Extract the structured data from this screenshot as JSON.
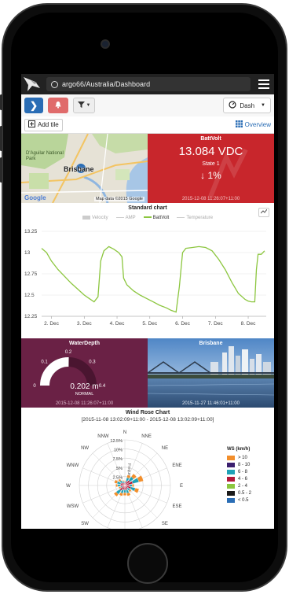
{
  "browser": {
    "url": "argo66/Australia/Dashboard"
  },
  "toolbar": {
    "dash_label": "Dash"
  },
  "toolbar2": {
    "add_tile_label": "Add tile",
    "overview_label": "Overview"
  },
  "map_tile": {
    "labels": [
      "D'Aguilar National Park",
      "Brisbane"
    ],
    "attribution": "Map data ©2015 Google",
    "google_logo": "Google"
  },
  "batt_tile": {
    "title": "BattVolt",
    "value": "13.084 VDC",
    "state": "State 1",
    "change": "1%",
    "timestamp": "2015-12-08 11:26:07+11:00",
    "color": "#c8262c"
  },
  "chart": {
    "title": "Standard chart",
    "legend": [
      {
        "name": "Velocity",
        "active": false,
        "kind": "box"
      },
      {
        "name": "AMP",
        "active": false,
        "kind": "line"
      },
      {
        "name": "BattVolt",
        "active": true,
        "kind": "line"
      },
      {
        "name": "Temperature",
        "active": false,
        "kind": "line"
      }
    ]
  },
  "chart_data": {
    "type": "line",
    "title": "Standard chart",
    "xlabel": "",
    "ylabel": "",
    "x_ticks": [
      "2. Dec",
      "3. Dec",
      "4. Dec",
      "5. Dec",
      "6. Dec",
      "7. Dec",
      "8. Dec"
    ],
    "y_ticks": [
      "12.25",
      "12.5",
      "12.75",
      "13",
      "13.25"
    ],
    "ylim": [
      12.25,
      13.25
    ],
    "xlim": [
      1.7,
      8.55
    ],
    "grid": true,
    "series": [
      {
        "name": "BattVolt",
        "color": "#8cc63f",
        "x": [
          1.7,
          1.85,
          2.0,
          2.2,
          2.4,
          2.6,
          2.8,
          3.0,
          3.15,
          3.3,
          3.42,
          3.5,
          3.6,
          3.75,
          3.9,
          4.05,
          4.15,
          4.2,
          4.3,
          4.5,
          4.7,
          4.9,
          5.1,
          5.3,
          5.5,
          5.65,
          5.8,
          5.9,
          6.0,
          6.1,
          6.3,
          6.5,
          6.7,
          6.9,
          7.1,
          7.3,
          7.5,
          7.7,
          7.9,
          8.0,
          8.1,
          8.2,
          8.25,
          8.3,
          8.4,
          8.5
        ],
        "y": [
          13.05,
          13.0,
          12.9,
          12.8,
          12.72,
          12.64,
          12.57,
          12.5,
          12.46,
          12.42,
          12.48,
          12.9,
          13.02,
          13.07,
          13.04,
          13.0,
          12.95,
          12.7,
          12.62,
          12.55,
          12.5,
          12.46,
          12.42,
          12.38,
          12.35,
          12.32,
          12.3,
          12.6,
          13.0,
          13.05,
          13.06,
          13.07,
          13.06,
          13.02,
          12.92,
          12.8,
          12.65,
          12.52,
          12.45,
          12.43,
          12.42,
          12.42,
          12.8,
          12.98,
          12.98,
          13.02
        ]
      }
    ]
  },
  "water_tile": {
    "title": "WaterDepth",
    "value": "0.202 m",
    "status": "NORMAL",
    "gauge_ticks": [
      "0",
      "0.1",
      "0.2",
      "0.3",
      "0.4"
    ],
    "gauge_value": 0.202,
    "gauge_max": 0.4,
    "timestamp": "2015-12-08 11:26:07+11:00"
  },
  "photo_tile": {
    "title": "Brisbane",
    "timestamp": "2015-11-27 11:46:01+11:00"
  },
  "wind": {
    "title": "Wind Rose Chart",
    "subtitle": "[2015-11-08 13:02:09+11:00 - 2015-12-08 13:02:09+11:00]",
    "directions": [
      "N",
      "NNE",
      "NE",
      "ENE",
      "E",
      "ESE",
      "SE",
      "SSE",
      "S",
      "SSW",
      "SW",
      "WSW",
      "W",
      "WNW",
      "NW",
      "NNW"
    ],
    "rings": [
      "2.5%",
      "5%",
      "7.5%",
      "10%",
      "12.5%"
    ],
    "axis_label": "Frequency (%)",
    "legend_title": "WS (km/h)",
    "legend": [
      {
        "label": "> 10",
        "color": "#f28e2b"
      },
      {
        "label": "8 - 10",
        "color": "#3b1f6e"
      },
      {
        "label": "6 - 8",
        "color": "#1fa1b7"
      },
      {
        "label": "4 - 6",
        "color": "#b3183a"
      },
      {
        "label": "2 - 4",
        "color": "#8cc63f"
      },
      {
        "label": "0.5 - 2",
        "color": "#1a1a1a"
      },
      {
        "label": "< 0.5",
        "color": "#2a6db5"
      }
    ]
  }
}
